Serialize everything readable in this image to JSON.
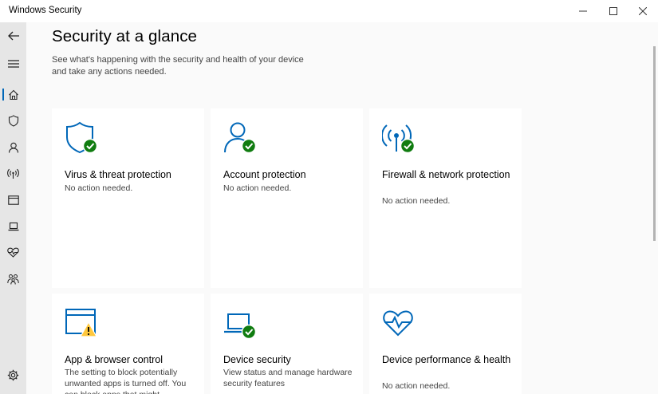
{
  "window": {
    "title": "Windows Security"
  },
  "sidebar": {
    "items": [
      {
        "name": "back",
        "icon": "back-arrow-icon"
      },
      {
        "name": "menu",
        "icon": "hamburger-icon"
      },
      {
        "name": "home",
        "icon": "home-icon",
        "active": true
      },
      {
        "name": "virus",
        "icon": "shield-icon"
      },
      {
        "name": "account",
        "icon": "person-icon"
      },
      {
        "name": "firewall",
        "icon": "wifi-icon"
      },
      {
        "name": "app-browser",
        "icon": "browser-window-icon"
      },
      {
        "name": "device-security",
        "icon": "laptop-icon"
      },
      {
        "name": "device-health",
        "icon": "heart-pulse-icon"
      },
      {
        "name": "family",
        "icon": "family-icon"
      },
      {
        "name": "settings",
        "icon": "gear-icon"
      }
    ]
  },
  "main": {
    "title": "Security at a glance",
    "subtitle": "See what's happening with the security and health of your device and take any actions needed.",
    "cards": [
      {
        "heading": "Virus & threat protection",
        "status": "No action needed.",
        "icon": "shield-icon",
        "badge": "ok"
      },
      {
        "heading": "Account protection",
        "status": "No action needed.",
        "icon": "person-icon",
        "badge": "ok"
      },
      {
        "heading": "Firewall & network protection",
        "status": "No action needed.",
        "icon": "wifi-icon",
        "badge": "ok"
      },
      {
        "heading": "App & browser control",
        "status": "The setting to block potentially unwanted apps is turned off. You can block apps that might...",
        "icon": "browser-window-icon",
        "badge": "warning"
      },
      {
        "heading": "Device security",
        "status": "View status and manage hardware security features",
        "icon": "laptop-icon",
        "badge": "ok"
      },
      {
        "heading": "Device performance & health",
        "status": "No action needed.",
        "icon": "heart-pulse-icon",
        "badge": "none"
      }
    ]
  },
  "colors": {
    "accent": "#0067b8",
    "ok": "#107c10",
    "warning": "#ffc83d",
    "sidebar_bg": "#e6e6e6"
  }
}
